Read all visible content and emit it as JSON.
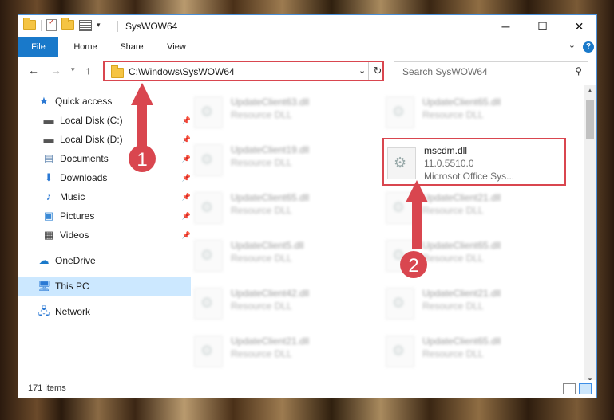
{
  "window": {
    "title": "SysWOW64",
    "controls": {
      "minimize": "─",
      "maximize": "☐",
      "close": "✕"
    }
  },
  "ribbon": {
    "tabs": [
      "File",
      "Home",
      "Share",
      "View"
    ],
    "help": "?"
  },
  "navigation": {
    "address": "C:\\Windows\\SysWOW64",
    "search_placeholder": "Search SysWOW64"
  },
  "sidebar": {
    "items": [
      {
        "label": "Quick access",
        "icon": "star-icon",
        "pinned": false
      },
      {
        "label": "Local Disk (C:)",
        "icon": "disk-icon",
        "pinned": true
      },
      {
        "label": "Local Disk (D:)",
        "icon": "disk-icon",
        "pinned": true
      },
      {
        "label": "Documents",
        "icon": "documents-icon",
        "pinned": true
      },
      {
        "label": "Downloads",
        "icon": "download-icon",
        "pinned": true
      },
      {
        "label": "Music",
        "icon": "music-icon",
        "pinned": true
      },
      {
        "label": "Pictures",
        "icon": "pictures-icon",
        "pinned": true
      },
      {
        "label": "Videos",
        "icon": "videos-icon",
        "pinned": true
      },
      {
        "label": "OneDrive",
        "icon": "cloud-icon",
        "pinned": false
      },
      {
        "label": "This PC",
        "icon": "pc-icon",
        "pinned": false,
        "selected": true
      },
      {
        "label": "Network",
        "icon": "network-icon",
        "pinned": false
      }
    ]
  },
  "files": {
    "left_column": [
      {
        "name": "UpdateClient63.dll",
        "type": "Resource DLL"
      },
      {
        "name": "UpdateClient19.dll",
        "type": "Resource DLL"
      },
      {
        "name": "UpdateClient65.dll",
        "type": "Resource DLL"
      },
      {
        "name": "UpdateClient5.dll",
        "type": "Resource DLL"
      },
      {
        "name": "UpdateClient42.dll",
        "type": "Resource DLL"
      },
      {
        "name": "UpdateClient21.dll",
        "type": "Resource DLL"
      }
    ],
    "right_column": [
      {
        "name": "UpdateClient65.dll",
        "type": "Resource DLL"
      },
      {
        "name": "UpdateClient21.dll",
        "type": "Resource DLL"
      },
      {
        "name": "UpdateClient65.dll",
        "type": "Resource DLL"
      },
      {
        "name": "UpdateClient21.dll",
        "type": "Resource DLL"
      },
      {
        "name": "UpdateClient65.dll",
        "type": "Resource DLL"
      }
    ],
    "highlighted": {
      "name": "mscdm.dll",
      "version": "11.0.5510.0",
      "description": "Microsot Office Sys..."
    }
  },
  "annotations": {
    "step1": "1",
    "step2": "2"
  },
  "status": {
    "item_count": "171 items"
  },
  "colors": {
    "accent": "#1979ca",
    "highlight": "#d9464f",
    "selected": "#cce8ff"
  }
}
